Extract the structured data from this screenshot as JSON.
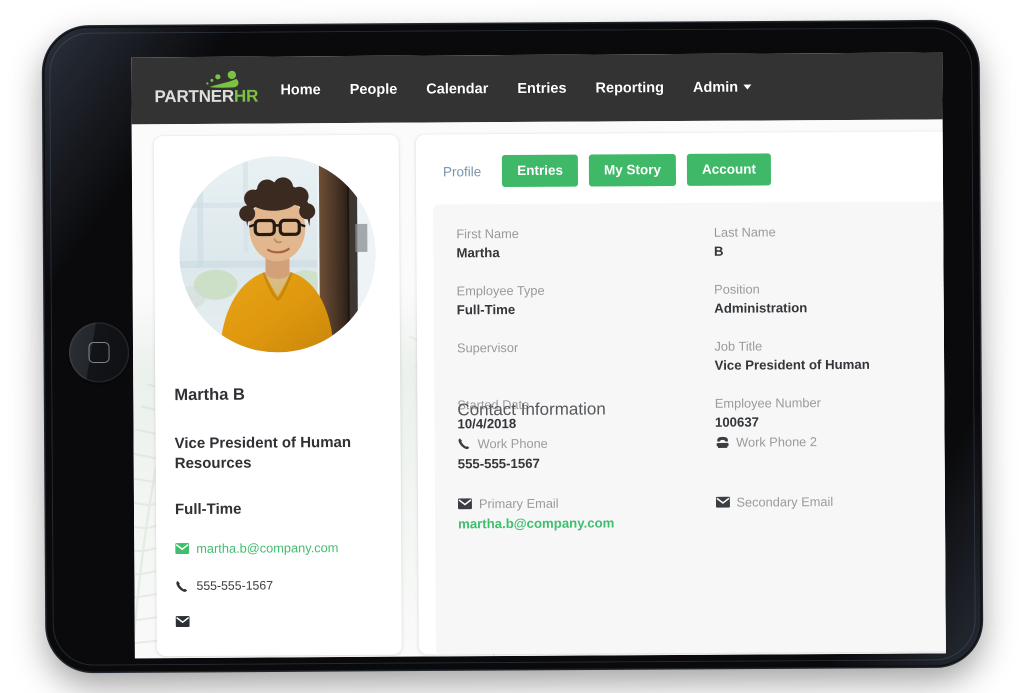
{
  "brand": {
    "logo_text_light": "PARTNER",
    "logo_text_accent": "HR",
    "accent_green": "#3fb867",
    "nav_bg": "#333333",
    "link_green": "#3fbe6e",
    "tab_link_color": "#7b94ad"
  },
  "navbar": {
    "items": [
      {
        "label": "Home",
        "icon": ""
      },
      {
        "label": "People",
        "icon": ""
      },
      {
        "label": "Calendar",
        "icon": ""
      },
      {
        "label": "Entries",
        "icon": ""
      },
      {
        "label": "Reporting",
        "icon": ""
      },
      {
        "label": "Admin",
        "icon": "chevron-down-icon"
      }
    ]
  },
  "profile_card": {
    "avatar_alt": "avatar-photo",
    "name": "Martha B",
    "title": "Vice President of Human Resources",
    "employee_type": "Full-Time",
    "email": "martha.b@company.com",
    "email_icon": "envelope-icon",
    "phone": "555-555-1567",
    "phone_icon": "phone-icon",
    "extra_icon": "envelope-icon",
    "extra_text": ""
  },
  "tabs": {
    "profile_label": "Profile",
    "buttons": [
      {
        "label": "Entries"
      },
      {
        "label": "My Story"
      },
      {
        "label": "Account"
      }
    ]
  },
  "details": {
    "fields": [
      {
        "label": "First Name",
        "value": "Martha"
      },
      {
        "label": "Last Name",
        "value": "B"
      },
      {
        "label": "Employee Type",
        "value": "Full-Time"
      },
      {
        "label": "Position",
        "value": "Administration"
      },
      {
        "label": "Supervisor",
        "value": ""
      },
      {
        "label": "Job Title",
        "value": "Vice President of Human"
      },
      {
        "label": "Started Date",
        "value": "10/4/2018"
      },
      {
        "label": "Employee Number",
        "value": "100637"
      }
    ]
  },
  "contact": {
    "heading": "Contact Information",
    "items": [
      {
        "label": "Work Phone",
        "value": "555-555-1567",
        "icon": "phone-icon",
        "green": false
      },
      {
        "label": "Work Phone 2",
        "value": "",
        "icon": "telephone-icon",
        "green": false
      },
      {
        "label": "Primary Email",
        "value": "martha.b@company.com",
        "icon": "envelope-icon",
        "green": true
      },
      {
        "label": "Secondary Email",
        "value": "",
        "icon": "envelope-icon",
        "green": false
      }
    ]
  },
  "device": {
    "home_button": "home-button"
  }
}
